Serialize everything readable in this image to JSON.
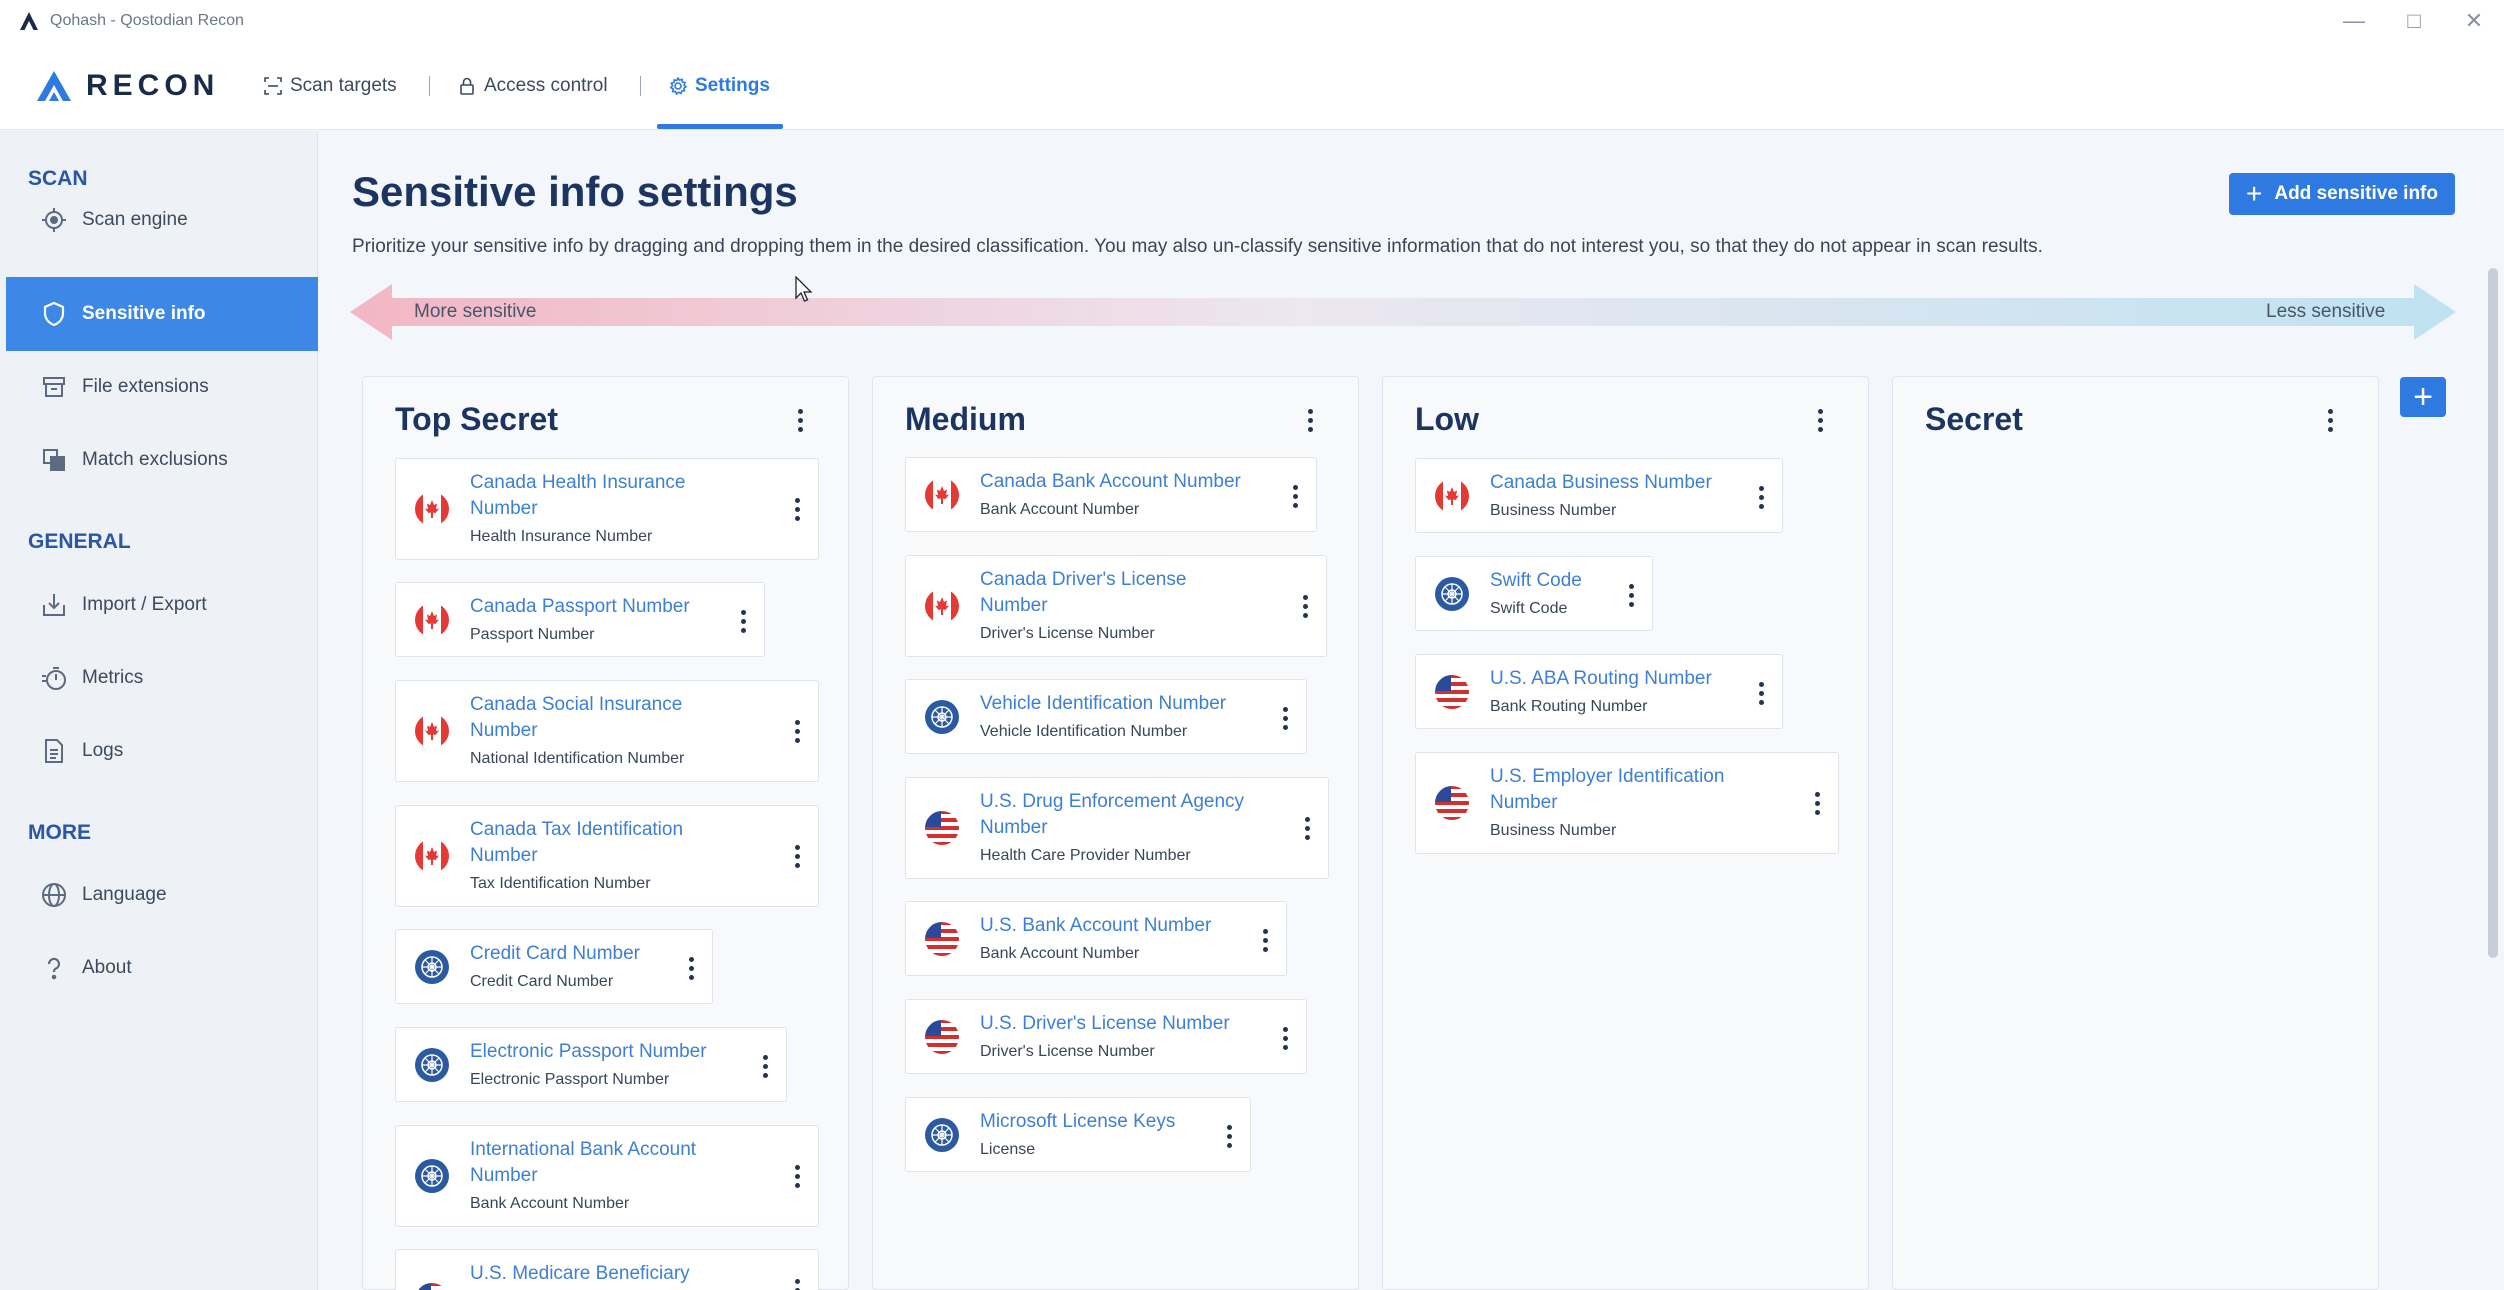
{
  "window": {
    "title": "Qohash - Qostodian Recon",
    "controls": [
      "minimize-icon",
      "maximize-icon",
      "close-icon"
    ]
  },
  "logo": {
    "text": "RECON",
    "color": "#2f7ae0"
  },
  "nav": {
    "tabs": [
      {
        "label": "Scan targets",
        "icon": "scan-icon"
      },
      {
        "label": "Access control",
        "icon": "lock-icon"
      },
      {
        "label": "Settings",
        "icon": "gear-icon",
        "active": true
      }
    ]
  },
  "sidebar": {
    "sections": [
      {
        "heading": "SCAN",
        "items": [
          {
            "label": "Scan engine",
            "icon": "scan-engine-icon"
          },
          {
            "label": "Sensitive info",
            "icon": "shield-icon",
            "active": true
          },
          {
            "label": "File extensions",
            "icon": "file-box-icon"
          },
          {
            "label": "Match exclusions",
            "icon": "squares-icon"
          }
        ]
      },
      {
        "heading": "GENERAL",
        "items": [
          {
            "label": "Import / Export",
            "icon": "import-icon"
          },
          {
            "label": "Metrics",
            "icon": "stopwatch-icon"
          },
          {
            "label": "Logs",
            "icon": "document-icon"
          }
        ]
      },
      {
        "heading": "MORE",
        "items": [
          {
            "label": "Language",
            "icon": "globe-icon"
          },
          {
            "label": "About",
            "icon": "question-icon"
          }
        ]
      }
    ]
  },
  "main": {
    "title": "Sensitive info settings",
    "description": "Prioritize your sensitive info by dragging and dropping them in the desired classification. You may also un-classify sensitive information that do not interest you, so that they do not appear in scan results.",
    "add_button": "Add sensitive info",
    "sensitivity": {
      "more": "More sensitive",
      "less": "Less sensitive"
    },
    "columns": [
      {
        "title": "Top Secret",
        "cards": [
          {
            "name": [
              "Canada Health Insurance",
              "Number"
            ],
            "sub": "Health Insurance Number",
            "flag": "canada-flag-icon"
          },
          {
            "name": [
              "Canada Passport Number"
            ],
            "sub": "Passport Number",
            "flag": "canada-flag-icon"
          },
          {
            "name": [
              "Canada Social Insurance",
              "Number"
            ],
            "sub": "National Identification Number",
            "flag": "canada-flag-icon"
          },
          {
            "name": [
              "Canada Tax Identification",
              "Number"
            ],
            "sub": "Tax Identification Number",
            "flag": "canada-flag-icon"
          },
          {
            "name": [
              "Credit Card Number"
            ],
            "sub": "Credit Card Number",
            "flag": "global-icon"
          },
          {
            "name": [
              "Electronic Passport Number"
            ],
            "sub": "Electronic Passport Number",
            "flag": "global-icon"
          },
          {
            "name": [
              "International Bank Account",
              "Number"
            ],
            "sub": "Bank Account Number",
            "flag": "global-icon"
          },
          {
            "name": [
              "U.S. Medicare Beneficiary"
            ],
            "sub": "",
            "flag": "us-flag-icon"
          }
        ]
      },
      {
        "title": "Medium",
        "cards": [
          {
            "name": [
              "Canada Bank Account Number"
            ],
            "sub": "Bank Account Number",
            "flag": "canada-flag-icon"
          },
          {
            "name": [
              "Canada Driver's License",
              "Number"
            ],
            "sub": "Driver's License Number",
            "flag": "canada-flag-icon"
          },
          {
            "name": [
              "Vehicle Identification Number"
            ],
            "sub": "Vehicle Identification Number",
            "flag": "global-icon"
          },
          {
            "name": [
              "U.S. Drug Enforcement Agency",
              "Number"
            ],
            "sub": "Health Care Provider Number",
            "flag": "us-flag-icon"
          },
          {
            "name": [
              "U.S. Bank Account Number"
            ],
            "sub": "Bank Account Number",
            "flag": "us-flag-icon"
          },
          {
            "name": [
              "U.S. Driver's License Number"
            ],
            "sub": "Driver's License Number",
            "flag": "us-flag-icon"
          },
          {
            "name": [
              "Microsoft License Keys"
            ],
            "sub": "License",
            "flag": "global-icon"
          }
        ]
      },
      {
        "title": "Low",
        "cards": [
          {
            "name": [
              "Canada Business Number"
            ],
            "sub": "Business Number",
            "flag": "canada-flag-icon"
          },
          {
            "name": [
              "Swift Code"
            ],
            "sub": "Swift Code",
            "flag": "global-icon"
          },
          {
            "name": [
              "U.S. ABA Routing Number"
            ],
            "sub": "Bank Routing Number",
            "flag": "us-flag-icon"
          },
          {
            "name": [
              "U.S. Employer Identification",
              "Number"
            ],
            "sub": "Business Number",
            "flag": "us-flag-icon"
          }
        ]
      },
      {
        "title": "Secret",
        "cards": []
      }
    ]
  },
  "colors": {
    "accent": "#2f7ae0",
    "title": "#1c3560",
    "link": "#3d7fd4"
  }
}
